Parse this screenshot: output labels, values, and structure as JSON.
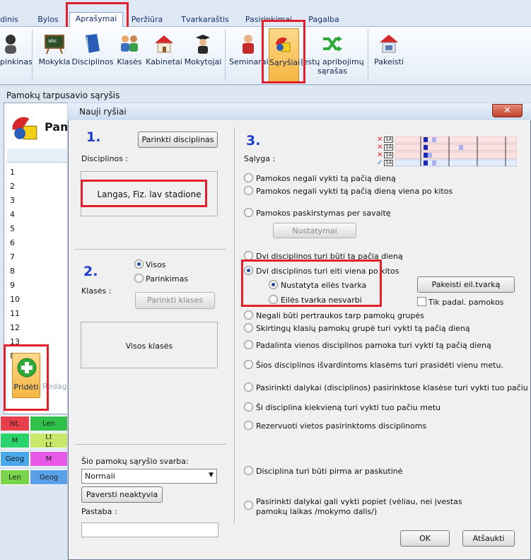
{
  "ribbon": {
    "tabs": [
      {
        "label": "dinis"
      },
      {
        "label": "Bylos"
      },
      {
        "label": "Aprašymai"
      },
      {
        "label": "Peržiūra"
      },
      {
        "label": "Tvarkaraštis"
      },
      {
        "label": "Pasirinkimai"
      },
      {
        "label": "Pagalba"
      }
    ],
    "buttons": [
      {
        "label": "pinkinas"
      },
      {
        "label": "Mokykla"
      },
      {
        "label": "Disciplinos"
      },
      {
        "label": "Klasės"
      },
      {
        "label": "Kabinetai"
      },
      {
        "label": "Mokytojai"
      },
      {
        "label": "Seminarai"
      },
      {
        "label": "Sąryšiai"
      },
      {
        "label": "Įestų apribojimų sąrašas"
      },
      {
        "label": "Pakeisti"
      }
    ]
  },
  "bg_window": {
    "title": "Pamokų tarpusavio sąryšis",
    "header_partial": "Pam",
    "rows": [
      "1",
      "2",
      "3",
      "4",
      "5",
      "6",
      "7",
      "8",
      "9",
      "10",
      "11",
      "12",
      "13",
      "8"
    ],
    "add_label": "Pridėti",
    "edit_label": "Redag",
    "grid": [
      [
        "ist.",
        "Len"
      ],
      [
        "M",
        "Lt\nLt"
      ],
      [
        "Geog",
        "M"
      ],
      [
        "Len",
        "Geog"
      ]
    ]
  },
  "dialog": {
    "title": "Nauji ryšiai",
    "close": "✕",
    "section1": {
      "number": "1.",
      "pick_button": "Parinkti disciplinas",
      "label": "Disciplinos :",
      "value": "Langas, Fiz. lav stadione"
    },
    "section2": {
      "number": "2.",
      "label": "Klasės :",
      "radio_all": "Visos",
      "radio_pick": "Parinkimas",
      "pick_button": "Parinkti klases",
      "value": "Visos klasės"
    },
    "weight": {
      "label": "Šio pamokų sąryšio svarba:",
      "value": "Normali",
      "inactive_button": "Paversti neaktyvia",
      "note_label": "Pastaba :",
      "note_value": ""
    },
    "section3": {
      "number": "3.",
      "label": "Sąlyga :",
      "options": [
        "Pamokos negali vykti tą pačią dieną",
        "Pamokos negali vykti tą pačią dieną viena po kitos",
        "Pamokos paskirstymas per savaitę",
        "Dvi disciplinos turi būti tą pačią dieną",
        "Dvi disciplinos turi eiti viena po kitos",
        "Negali būti pertraukos tarp pamokų grupės",
        "Skirtingų klasių pamokų grupė turi vykti tą pačią dieną",
        "Padalinta vienos disciplinos pamoka turi vykti tą pačią dieną",
        "Šios disciplinos išvardintoms klasėms turi prasidėti vienu metu.",
        "Pasirinkti dalykai (disciplinos) pasirinktose klasėse turi vykti tuo pačiu metu.",
        "Ši disciplina kiekvieną turi vykti tuo pačiu metu",
        "Rezervuoti vietos pasirinktoms disciplinoms",
        "Disciplina turi būti pirma ar paskutinė",
        "Pasirinkti dalykai gali vykti popiet (vėliau, nei įvestas pamokų laikas /mokymo dalis/)"
      ],
      "selected_index": 4,
      "settings_button": "Nustatymai",
      "sub_fixed": "Nustatyta eilės tvarka",
      "sub_any": "Eilės tvarka nesvarbi",
      "change_order_button": "Pakeisti eil.tvarką",
      "only_split": "Tik padal. pamokos",
      "legend_marks": [
        "✕",
        "✕",
        "✕",
        "✓"
      ],
      "legend_tag": "1A"
    },
    "ok": "OK",
    "cancel": "Atšaukti"
  },
  "colors": {
    "highlight_box": "#e0202a",
    "section_number": "#1e3fc9"
  }
}
